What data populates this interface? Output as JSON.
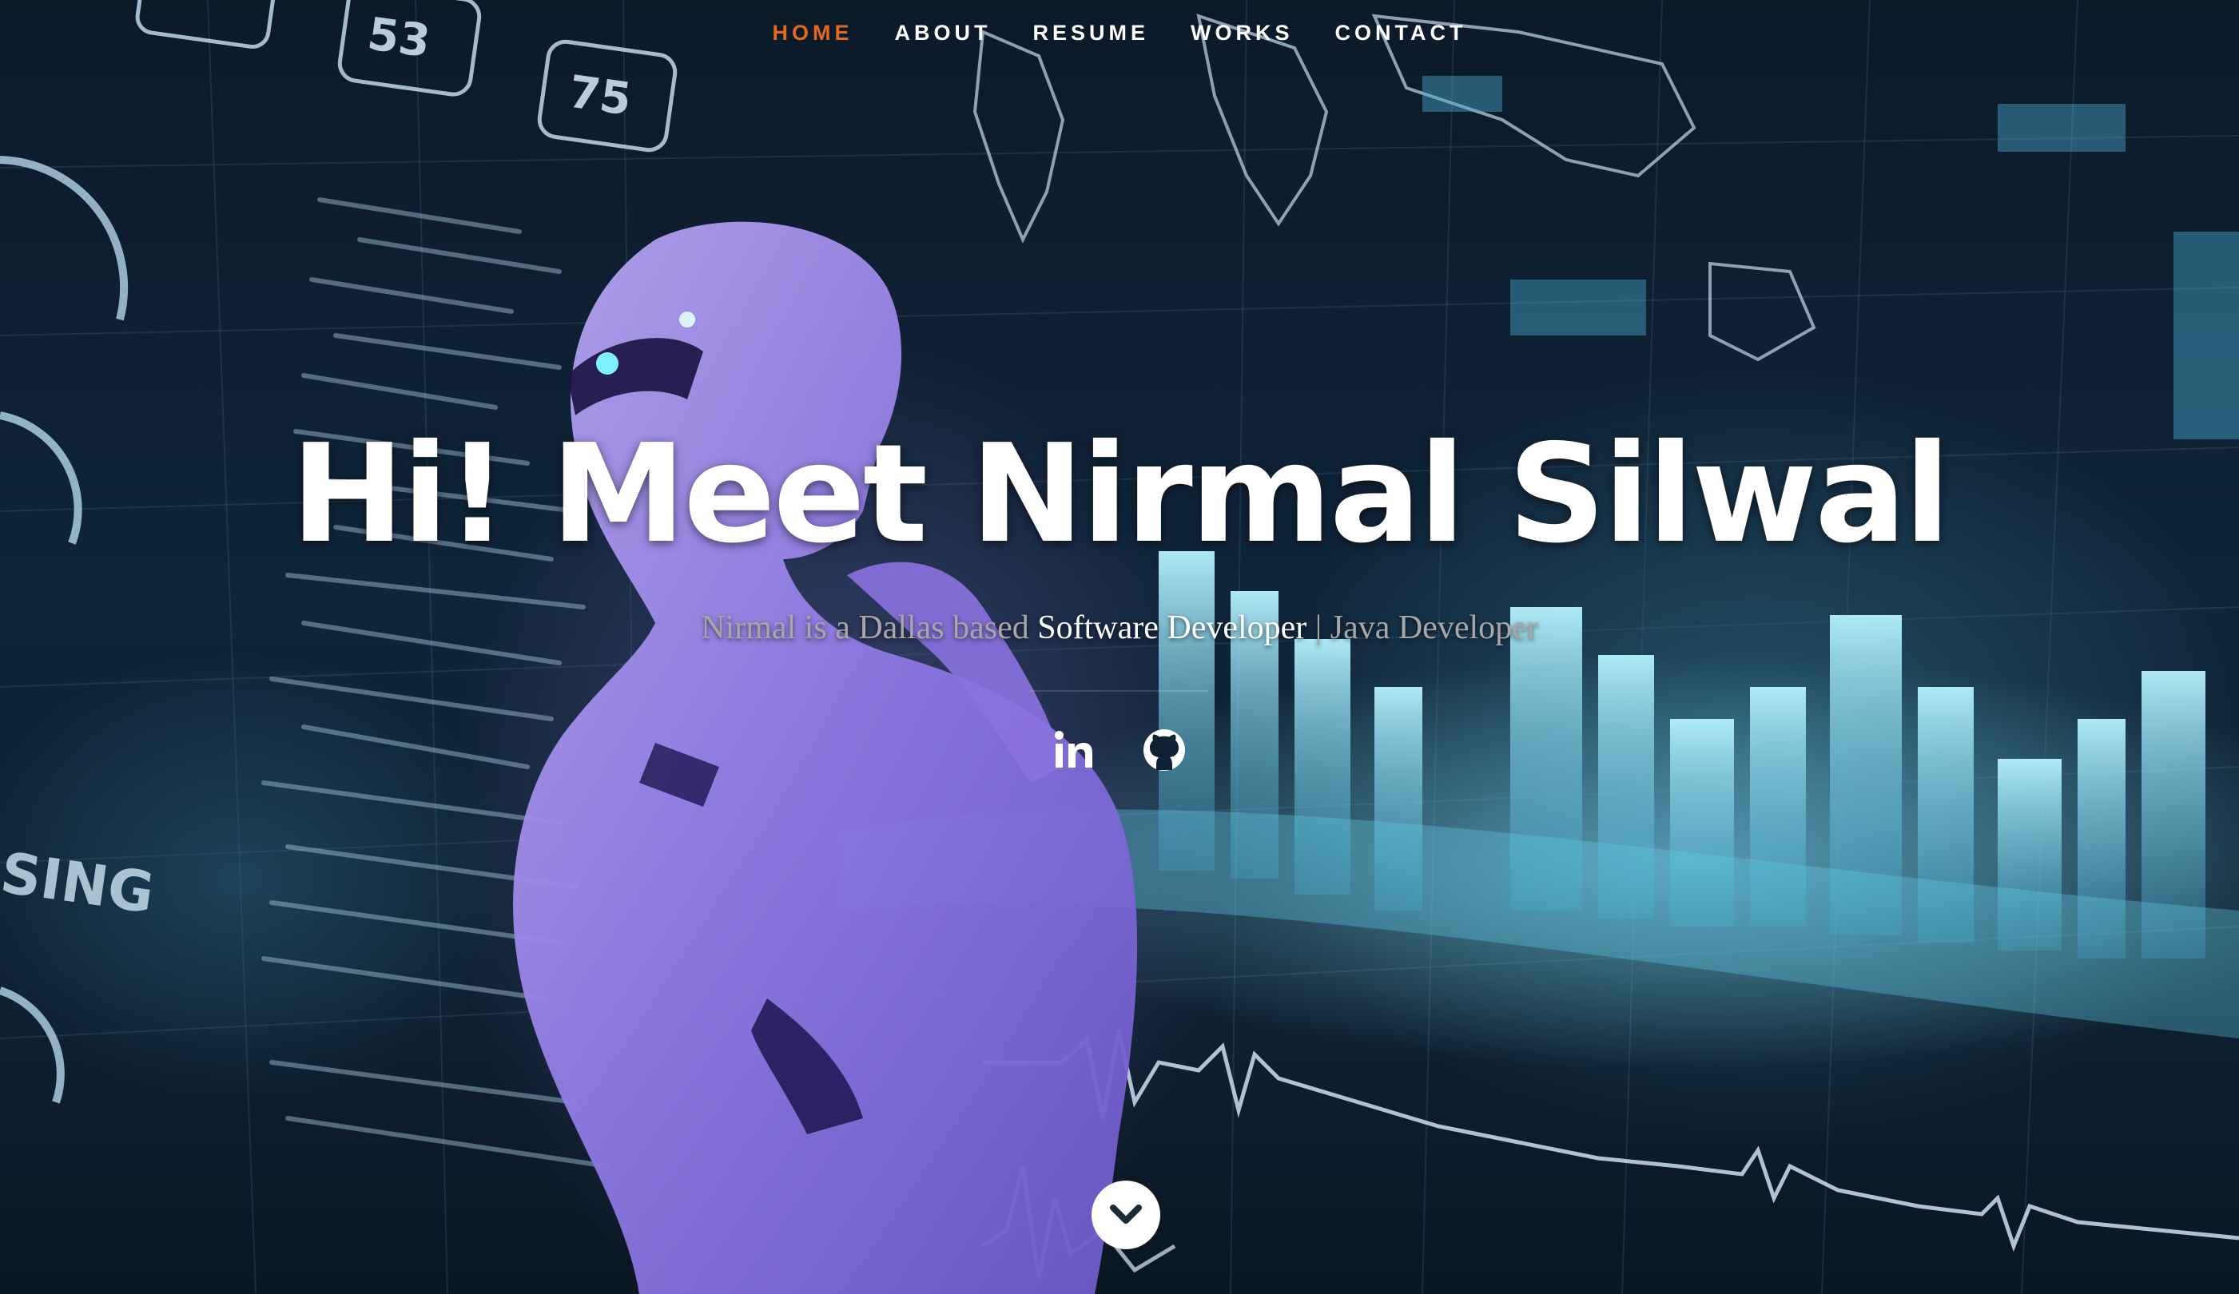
{
  "nav": {
    "items": [
      {
        "label": "HOME",
        "active": true
      },
      {
        "label": "ABOUT",
        "active": false
      },
      {
        "label": "RESUME",
        "active": false
      },
      {
        "label": "WORKS",
        "active": false
      },
      {
        "label": "CONTACT",
        "active": false
      }
    ]
  },
  "hero": {
    "title": "Hi! Meet Nirmal Silwal",
    "subtitle_prefix": "Nirmal is a Dallas based ",
    "subtitle_role": "Software Developer",
    "subtitle_separator": " | ",
    "subtitle_suffix": "Java Developer"
  },
  "social": {
    "linkedin_icon": "linkedin-icon",
    "github_icon": "github-icon"
  },
  "scroll": {
    "icon": "chevron-down-icon"
  },
  "colors": {
    "accent": "#e5691c",
    "nav_text": "#ffffff",
    "subtitle_muted": "#a7a7a7"
  },
  "background": {
    "hud_numbers": [
      "53",
      "75"
    ],
    "hud_text": "SING"
  }
}
